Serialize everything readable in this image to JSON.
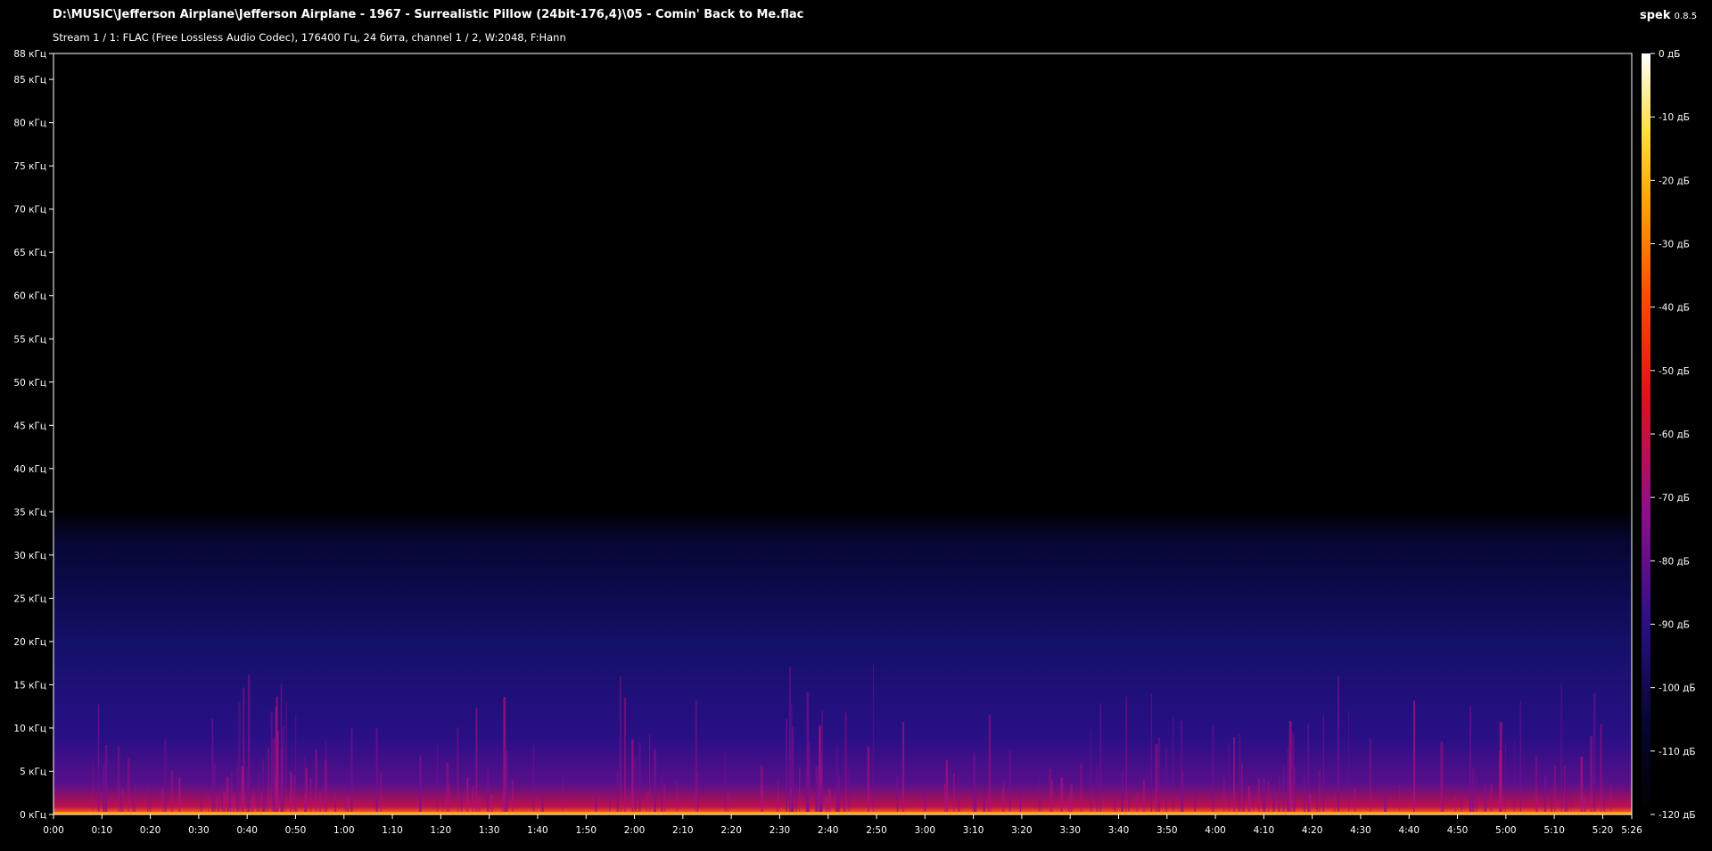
{
  "header": {
    "file_path": "D:\\MUSIC\\Jefferson Airplane\\Jefferson Airplane - 1967 - Surrealistic Pillow (24bit-176,4)\\05 - Comin' Back to Me.flac",
    "stream_info": "Stream 1 / 1: FLAC (Free Lossless Audio Codec), 176400 Гц, 24 бита, channel 1 / 2, W:2048, F:Hann"
  },
  "app": {
    "name": "spek",
    "version": "0.8.5"
  },
  "colors": {
    "background": "#000000",
    "axis": "#ffffff",
    "palette": [
      "#000000",
      "#060632",
      "#1a0d6b",
      "#4b0f8f",
      "#8f0f8a",
      "#c8104a",
      "#f0261a",
      "#ff7a00",
      "#ffd000",
      "#ffffaa",
      "#ffffff"
    ]
  },
  "chart_data": {
    "type": "heatmap",
    "title": "",
    "xlabel": "",
    "ylabel": "",
    "y_unit": "кГц",
    "y_range": [
      0,
      88
    ],
    "y_ticks": [
      "0 кГц",
      "5 кГц",
      "10 кГц",
      "15 кГц",
      "20 кГц",
      "25 кГц",
      "30 кГц",
      "35 кГц",
      "40 кГц",
      "45 кГц",
      "50 кГц",
      "55 кГц",
      "60 кГц",
      "65 кГц",
      "70 кГц",
      "75 кГц",
      "80 кГц",
      "85 кГц",
      "88 кГц"
    ],
    "y_tick_values": [
      0,
      5,
      10,
      15,
      20,
      25,
      30,
      35,
      40,
      45,
      50,
      55,
      60,
      65,
      70,
      75,
      80,
      85,
      88
    ],
    "x_range_seconds": [
      0,
      326
    ],
    "x_ticks": [
      "0:00",
      "0:10",
      "0:20",
      "0:30",
      "0:40",
      "0:50",
      "1:00",
      "1:10",
      "1:20",
      "1:30",
      "1:40",
      "1:50",
      "2:00",
      "2:10",
      "2:20",
      "2:30",
      "2:40",
      "2:50",
      "3:00",
      "3:10",
      "3:20",
      "3:30",
      "3:40",
      "3:50",
      "4:00",
      "4:10",
      "4:20",
      "4:30",
      "4:40",
      "4:50",
      "5:00",
      "5:10",
      "5:20",
      "5:26"
    ],
    "x_tick_values": [
      0,
      10,
      20,
      30,
      40,
      50,
      60,
      70,
      80,
      90,
      100,
      110,
      120,
      130,
      140,
      150,
      160,
      170,
      180,
      190,
      200,
      210,
      220,
      230,
      240,
      250,
      260,
      270,
      280,
      290,
      300,
      310,
      320,
      326
    ],
    "colorbar_range_db": [
      -120,
      0
    ],
    "colorbar_ticks": [
      "0 дБ",
      "-10 дБ",
      "-20 дБ",
      "-30 дБ",
      "-40 дБ",
      "-50 дБ",
      "-60 дБ",
      "-70 дБ",
      "-80 дБ",
      "-90 дБ",
      "-100 дБ",
      "-110 дБ",
      "-120 дБ"
    ],
    "colorbar_tick_values": [
      0,
      -10,
      -20,
      -30,
      -40,
      -50,
      -60,
      -70,
      -80,
      -90,
      -100,
      -110,
      -120
    ],
    "content_cutoff_khz": 32
  }
}
